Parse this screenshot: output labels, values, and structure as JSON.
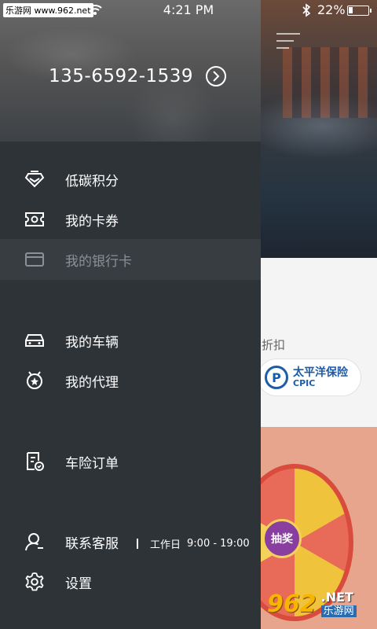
{
  "status_bar": {
    "watermark": "乐游网 www.962.net",
    "time": "4:21 PM",
    "battery": "22%"
  },
  "drawer": {
    "phone": "135-6592-1539",
    "menu": [
      {
        "label": "低碳积分",
        "icon": "badge-icon"
      },
      {
        "label": "我的卡券",
        "icon": "ticket-icon"
      },
      {
        "label": "我的银行卡",
        "icon": "bank-card-icon",
        "disabled": true
      },
      {
        "label": "我的车辆",
        "icon": "car-icon"
      },
      {
        "label": "我的代理",
        "icon": "agent-icon"
      },
      {
        "label": "车险订单",
        "icon": "order-icon"
      },
      {
        "label": "联系客服",
        "icon": "customer-service-icon"
      },
      {
        "label": "设置",
        "icon": "gear-icon"
      }
    ],
    "service_hours": {
      "day": "工作日",
      "time": "9:00 - 19:00"
    }
  },
  "background": {
    "discount_text": "的折扣",
    "insurer_cn": "太平洋保险",
    "insurer_en": "CPIC",
    "lottery_button": "抽奖",
    "watermark_num": "962",
    "watermark_net": ".NET",
    "watermark_cn": "乐游网"
  }
}
